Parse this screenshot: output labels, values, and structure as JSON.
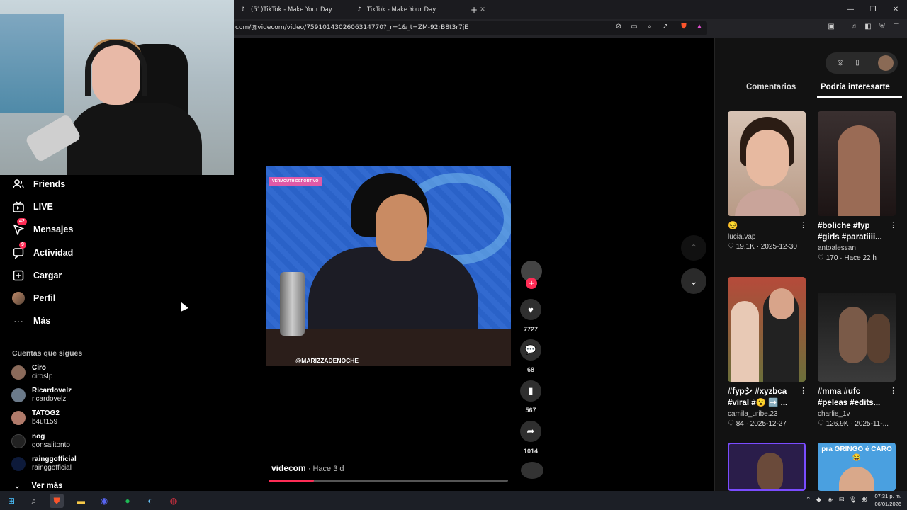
{
  "browser": {
    "tabs": [
      {
        "title": "(51)TikTok - Make Your Day"
      },
      {
        "title": "TikTok - Make Your Day"
      }
    ],
    "url": "com/@videcom/video/7591014302606314770?_r=1&_t=ZM-92rB8t3r7jE"
  },
  "sidebar": {
    "items": [
      {
        "label": "Friends",
        "icon": "friends-icon"
      },
      {
        "label": "LIVE",
        "icon": "live-icon"
      },
      {
        "label": "Mensajes",
        "icon": "messages-icon",
        "badge": "42"
      },
      {
        "label": "Actividad",
        "icon": "activity-icon",
        "badge": "9"
      },
      {
        "label": "Cargar",
        "icon": "upload-icon"
      },
      {
        "label": "Perfil",
        "icon": "profile-icon"
      },
      {
        "label": "Más",
        "icon": "more-icon"
      }
    ],
    "following_title": "Cuentas que sigues",
    "accounts": [
      {
        "name": "Ciro",
        "user": "cirosIp"
      },
      {
        "name": "Ricardovelz",
        "user": "ricardovelz"
      },
      {
        "name": "TATOG2",
        "user": "b4ut159"
      },
      {
        "name": "nog",
        "user": "gonsalitonto"
      },
      {
        "name": "rainggofficial",
        "user": "rainggofficial"
      }
    ],
    "see_more": "Ver más"
  },
  "video": {
    "tag": "VERMOUTH DEPORTIVO",
    "watermark": "@MARIZZADENOCHE",
    "author": "videcom",
    "age": " · Hace 3 d",
    "progress": 0.19
  },
  "actions": {
    "likes": "7727",
    "comments": "68",
    "saves": "567",
    "shares": "1014"
  },
  "right_panel": {
    "tabs": {
      "comments": "Comentarios",
      "interest": "Podría interesarte"
    },
    "cards": [
      {
        "title": "😔",
        "user": "lucia.vap",
        "likes": "19.1K",
        "date": "2025-12-30"
      },
      {
        "title": "#boliche #fyp #girls #paratiiii...",
        "title2": "#girls #paratiiii...",
        "title1": "#boliche #fyp",
        "user": "antoalessan",
        "likes": "170",
        "date": "Hace 22 h"
      },
      {
        "title1": "#fypシ #xyzbca",
        "title2": "#viral #😮 ➡️ ...",
        "user": "camila_uribe.23",
        "likes": "84",
        "date": "2025-12-27"
      },
      {
        "title1": "#mma #ufc",
        "title2": "#peleas #edits...",
        "user": "charlie_1v",
        "likes": "126.9K",
        "date": "2025-11-..."
      },
      {
        "thumb_text": "pra GRINGO é CARO 😂"
      }
    ]
  },
  "taskbar": {
    "time": "07:31 p. m.",
    "date": "06/01/2026"
  }
}
